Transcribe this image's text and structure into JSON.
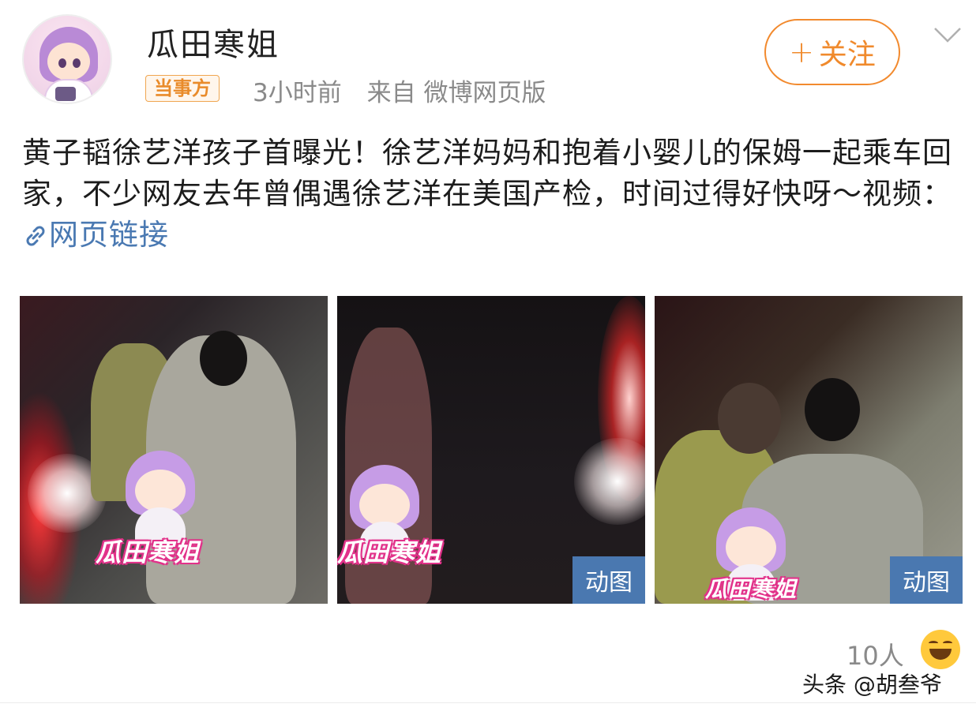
{
  "header": {
    "username": "瓜田寒姐",
    "badge": "当事方",
    "time": "3小时前",
    "source": "来自 微博网页版",
    "follow_label": "关注",
    "follow_plus": "+"
  },
  "post": {
    "text": "黄子韬徐艺洋孩子首曝光！徐艺洋妈妈和抱着小婴儿的保姆一起乘车回家，不少网友去年曾偶遇徐艺洋在美国产检，时间过得好快呀～视频：",
    "link_label": "网页链接"
  },
  "media": [
    {
      "sticker_text": "瓜田寒姐",
      "tag": ""
    },
    {
      "sticker_text": "瓜田寒姐",
      "tag": ""
    },
    {
      "sticker_text": "瓜田寒姐",
      "tag": "动图"
    }
  ],
  "media_tag_2": "动图",
  "footer": {
    "likes": "10人",
    "watermark": "头条 @胡叁爷"
  },
  "colors": {
    "accent": "#f08a2c",
    "link": "#4a79b2",
    "gif_tag": "#4a78b0"
  }
}
